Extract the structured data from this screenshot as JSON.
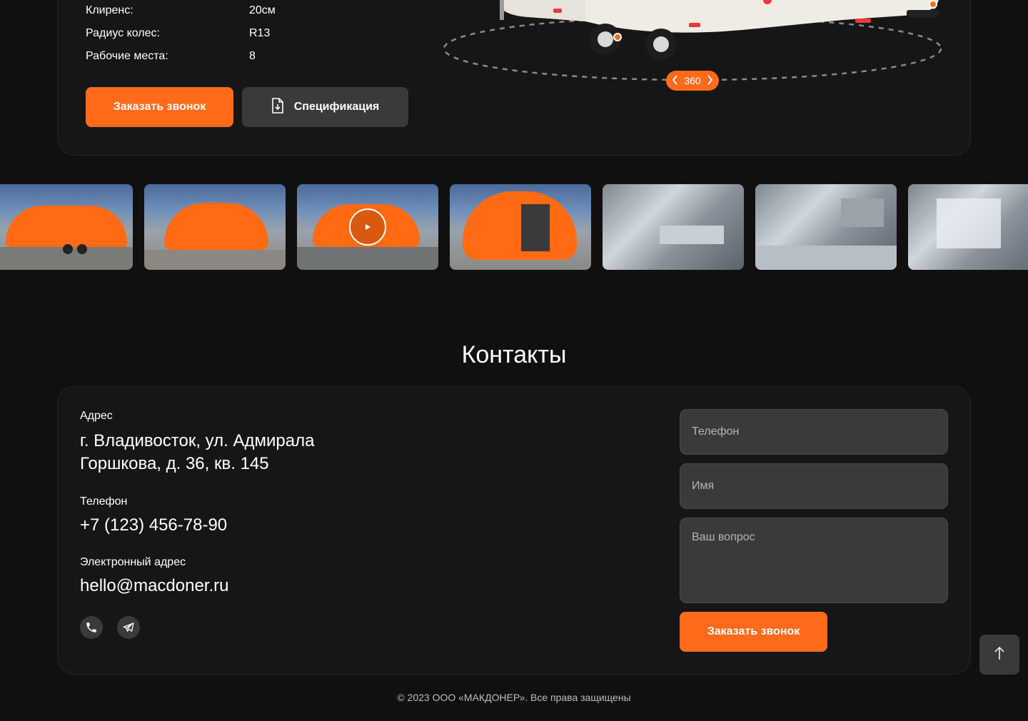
{
  "specs": [
    {
      "label": "Клиренс:",
      "value": "20см"
    },
    {
      "label": "Радиус колес:",
      "value": "R13"
    },
    {
      "label": "Рабочие места:",
      "value": "8"
    }
  ],
  "product_actions": {
    "call_label": "Заказать звонок",
    "spec_label": "Спецификация"
  },
  "viewer": {
    "badge_text": "360",
    "left_icon": "chevron-left-icon",
    "right_icon": "chevron-right-icon"
  },
  "gallery": {
    "items": [
      "photo",
      "photo",
      "video",
      "photo",
      "photo",
      "photo",
      "photo"
    ]
  },
  "contacts": {
    "title": "Контакты",
    "address_label": "Адрес",
    "address_line1": "г. Владивосток, ул. Адмирала",
    "address_line2": "Горшкова, д. 36, кв. 145",
    "phone_label": "Телефон",
    "phone_value": "+7 (123) 456-78-90",
    "email_label": "Электронный адрес",
    "email_value": "hello@macdoner.ru",
    "social_icons": [
      "phone-icon",
      "telegram-icon"
    ]
  },
  "form": {
    "phone_placeholder": "Телефон",
    "name_placeholder": "Имя",
    "question_placeholder": "Ваш вопрос",
    "submit_label": "Заказать звонок"
  },
  "footer": {
    "copyright": "© 2023 ООО «МАКДОНЕР». Все права защищены"
  },
  "colors": {
    "accent": "#ff6b1a",
    "background": "#101010",
    "card": "#161616",
    "field": "#3a3a3a"
  }
}
